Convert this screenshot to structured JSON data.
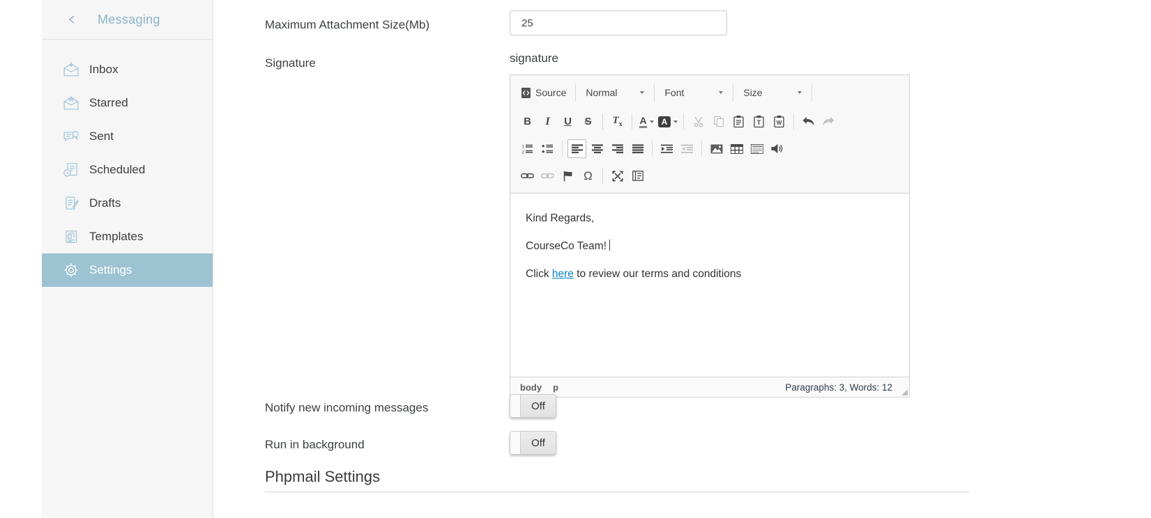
{
  "sidebar": {
    "title": "Messaging",
    "items": [
      {
        "label": "Inbox"
      },
      {
        "label": "Starred"
      },
      {
        "label": "Sent"
      },
      {
        "label": "Scheduled"
      },
      {
        "label": "Drafts"
      },
      {
        "label": "Templates"
      },
      {
        "label": "Settings"
      }
    ],
    "colors": {
      "bg": "#f6f6f6",
      "title": "#89b6cb",
      "icon": "#a6c9da",
      "active_bg": "#9dc3d3",
      "active_text": "#ffffff"
    }
  },
  "form": {
    "max_attachment_label": "Maximum Attachment Size(Mb)",
    "max_attachment_value": "25",
    "signature_label": "Signature",
    "signature_field_label": "signature",
    "notify_label": "Notify new incoming messages",
    "notify_toggle": "Off",
    "run_bg_label": "Run in background",
    "run_bg_toggle": "Off",
    "phpmail_heading": "Phpmail Settings"
  },
  "editor": {
    "toolbar": {
      "source": "Source",
      "format": "Normal",
      "font": "Font",
      "size": "Size",
      "bold": "B",
      "italic": "I",
      "underline": "U",
      "strike": "S",
      "removeformat_main": "T",
      "removeformat_sub": "x",
      "textcolor": "A",
      "bgcolor": "A",
      "paste_plain": "T",
      "paste_word": "W",
      "numlist_digit1": "1",
      "numlist_digit2": "2",
      "omega": "Ω"
    },
    "content": {
      "para1": "Kind Regards,",
      "para2": "CourseCo Team!",
      "para3_prefix": "Click ",
      "para3_link": "here",
      "para3_suffix": " to review our terms and conditions"
    },
    "footer": {
      "el_body": "body",
      "el_p": "p",
      "stats": "Paragraphs: 3, Words: 12"
    },
    "colors": {
      "link": "#0782c1",
      "toolbar_bg": "#f8f8f8",
      "border": "#d1d1d1"
    }
  }
}
